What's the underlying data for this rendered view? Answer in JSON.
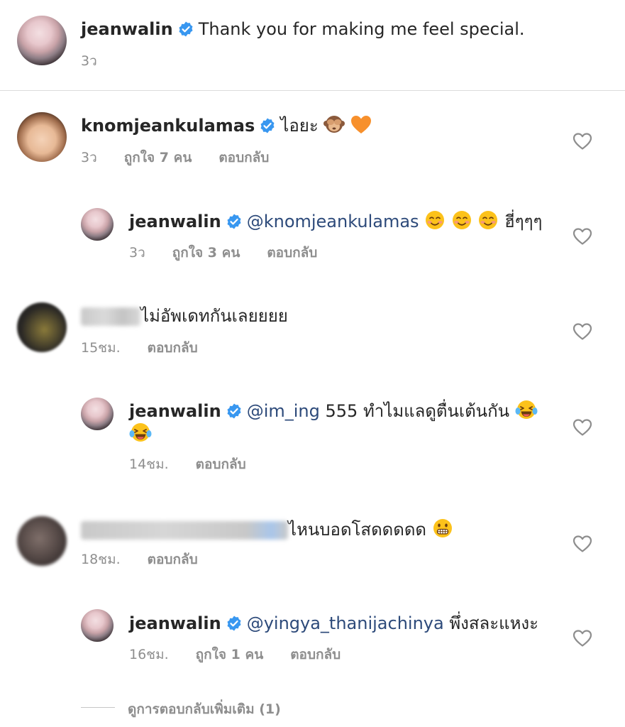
{
  "caption": {
    "username": "jeanwalin",
    "text": "Thank you for making me feel special.",
    "time": "3ว"
  },
  "comments": [
    {
      "username": "knomjeankulamas",
      "text": "ไอยะ",
      "time": "3ว",
      "likes": "ถูกใจ 7 คน",
      "reply": "ตอบกลับ"
    },
    {
      "username": "jeanwalin",
      "mention": "@knomjeankulamas",
      "text": "ฮี่ๆๆๆ",
      "time": "3ว",
      "likes": "ถูกใจ 3 คน",
      "reply": "ตอบกลับ"
    },
    {
      "text": "ไม่อัพเดทกันเลยยยย",
      "time": "15ชม.",
      "reply": "ตอบกลับ"
    },
    {
      "username": "jeanwalin",
      "mention": "@im_ing",
      "text": "555 ทำไมแลดูตื่นเต้นกัน",
      "time": "14ชม.",
      "reply": "ตอบกลับ"
    },
    {
      "text": "ไหนบอดโสดดดดด",
      "time": "18ชม.",
      "reply": "ตอบกลับ"
    },
    {
      "username": "jeanwalin",
      "mention": "@yingya_thanijachinya",
      "text": "พึ่งสละแหงะ",
      "time": "16ชม.",
      "likes": "ถูกใจ 1 คน",
      "reply": "ตอบกลับ"
    }
  ],
  "view_more": "ดูการตอบกลับเพิ่มเติม (1)",
  "colors": {
    "verified": "#3897f0",
    "mention": "#2d4a7a",
    "meta": "#8e8e8e"
  }
}
